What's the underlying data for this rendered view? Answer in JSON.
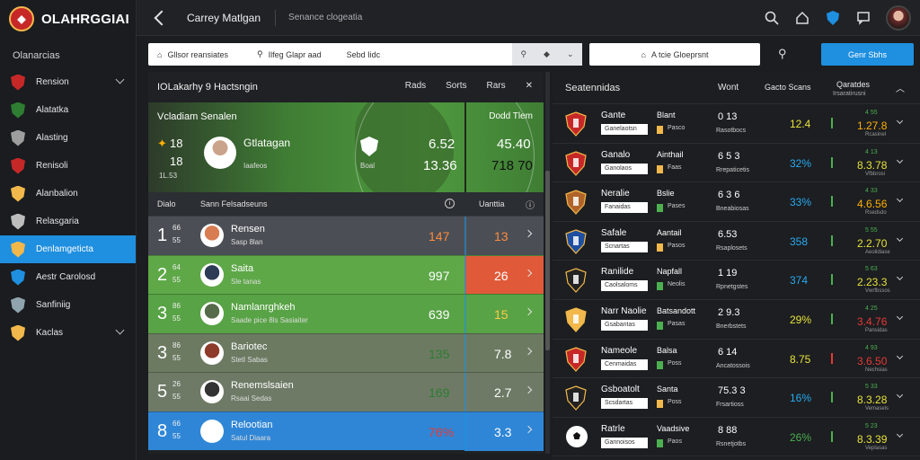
{
  "brand": {
    "name": "OLAHRGGIAI"
  },
  "sidebar": {
    "section": "Olanarcias",
    "items": [
      {
        "label": "Rension",
        "color": "#c62828",
        "chevron": true
      },
      {
        "label": "Alatatka",
        "color": "#2e7d32",
        "chevron": false
      },
      {
        "label": "Alasting",
        "color": "#9e9e9e",
        "chevron": false
      },
      {
        "label": "Renisoli",
        "color": "#c62828",
        "chevron": false
      },
      {
        "label": "Alanbalion",
        "color": "#f2b84b",
        "chevron": false
      },
      {
        "label": "Relasgaria",
        "color": "#bdbdbd",
        "chevron": false
      },
      {
        "label": "Denlamgeticta",
        "color": "#f2b84b",
        "chevron": false,
        "active": true
      },
      {
        "label": "Aestr Carolosd",
        "color": "#1f8fe0",
        "chevron": false
      },
      {
        "label": "Sanfiniig",
        "color": "#90a4ae",
        "chevron": false
      },
      {
        "label": "Kaclas",
        "color": "#f2b84b",
        "chevron": true
      }
    ]
  },
  "topbar": {
    "title": "Carrey Matlgan",
    "subtitle": "Senance clogeatia"
  },
  "filters": {
    "a": "Gllsor reansiates",
    "b": "Ilfeg Glapr aad",
    "c": "Sebd Iidc",
    "search": "A tcie Gloeprsnt",
    "button": "Genr Sbhs"
  },
  "panel": {
    "title": "IOLakarhy 9 Hactsngin",
    "cols": [
      "Rads",
      "Sorts",
      "Rars"
    ],
    "hero": {
      "title": "Vcladiam Senalen",
      "right_title": "Dodd Tlem",
      "n1": "18",
      "n2": "18",
      "n3": "1L.53",
      "name": "Gtlatagan",
      "name_sub": "Iaafeos",
      "badge_sub": "Boal",
      "s1": "6.52",
      "s2": "13.36",
      "r1": "45.40",
      "r2": "718 70"
    },
    "sub_header": {
      "a": "Dialo",
      "b": "Sann Felsadseuns",
      "c": "Uanttia"
    },
    "rows": [
      {
        "rank": "1",
        "s1": "66",
        "s2": "55",
        "name": "Rensen",
        "sub": "Sasp 8lan",
        "v1": "147",
        "v2": "13",
        "v1c": "#ff8a3d",
        "v2c": "#ff8a3d",
        "bg": "#4b4f55",
        "cell": "#4b4f55",
        "photo": "#d87c52"
      },
      {
        "rank": "2",
        "s1": "64",
        "s2": "55",
        "name": "Saita",
        "sub": "Sle tanas",
        "v1": "997",
        "v2": "26",
        "v1c": "#ffffff",
        "v2c": "#ffffff",
        "bg": "#5ea848",
        "cell": "#e05a3a",
        "photo": "#2e3b55"
      },
      {
        "rank": "3",
        "s1": "86",
        "s2": "55",
        "name": "Namlanrghkeh",
        "sub": "Saade pice 8ls Sasiaiter",
        "v1": "639",
        "v2": "15",
        "v1c": "#ffffff",
        "v2c": "#ffc94a",
        "bg": "#58a345",
        "cell": "#58a345",
        "photo": "#556b4a"
      },
      {
        "rank": "3",
        "s1": "86",
        "s2": "55",
        "name": "Bariotec",
        "sub": "Stetl Sabas",
        "v1": "135",
        "v2": "7.8",
        "v1c": "#2e7d32",
        "v2c": "#ffffff",
        "bg": "#6c7a62",
        "cell": "#6c7a62",
        "photo": "#8d3b2a"
      },
      {
        "rank": "5",
        "s1": "26",
        "s2": "55",
        "name": "Renemslsaien",
        "sub": "Rsaai Sedas",
        "v1": "169",
        "v2": "2.7",
        "v1c": "#2e7d32",
        "v2c": "#ffffff",
        "bg": "#6e7a66",
        "cell": "#6e7a66",
        "photo": "#333333"
      },
      {
        "rank": "8",
        "s1": "66",
        "s2": "55",
        "name": "Relootian",
        "sub": "Satul Diaara",
        "v1": "76%",
        "v2": "3.3",
        "v1c": "#e53935",
        "v2c": "#ffffff",
        "bg": "#2f86d6",
        "cell": "#2f86d6",
        "photo": "#ffffff"
      }
    ]
  },
  "rpanel": {
    "title": "Seatennidas",
    "cols": [
      "Wont",
      "Gacto Scans",
      "Qaratdes",
      "Irsaratirusni"
    ],
    "rows": [
      {
        "team": "Gante",
        "tag": "Ganelaotsn",
        "sub": "Blant",
        "sub2": "Pasco",
        "sq": "#f2b84b",
        "n1": "0 13",
        "n2": "Rasotbocs",
        "pct": "12.4",
        "pctc": "#e8e23a",
        "barc": "#4caf50",
        "oddtop": "4 55",
        "odd": "1.27.8",
        "oddc": "#ffb000",
        "odd2": "Rcasinel",
        "crest": "#c62828"
      },
      {
        "team": "Ganalo",
        "tag": "Ganolaos",
        "sub": "Ainthail",
        "sub2": "Faas",
        "sq": "#f2b84b",
        "n1": "6 5 3",
        "n2": "Rrepaticetis",
        "pct": "32%",
        "pctc": "#29a9f0",
        "barc": "#4caf50",
        "oddtop": "4 13",
        "odd": "8.3.78",
        "oddc": "#e8e23a",
        "odd2": "Vfbbrosi",
        "crest": "#c62828"
      },
      {
        "team": "Neralie",
        "tag": "Fanaidas",
        "sub": "Bslie",
        "sub2": "Pases",
        "sq": "#4caf50",
        "n1": "6 3 6",
        "n2": "Bneabiosas",
        "pct": "33%",
        "pctc": "#29a9f0",
        "barc": "#4caf50",
        "oddtop": "4 33",
        "odd": "4.6.56",
        "oddc": "#ffb000",
        "odd2": "Rsedsdo",
        "crest": "#b0642a"
      },
      {
        "team": "Safale",
        "tag": "Scnartas",
        "sub": "Aantail",
        "sub2": "Pasos",
        "sq": "#f2b84b",
        "n1": "6.53",
        "n2": "Rsaplosets",
        "pct": "358",
        "pctc": "#29a9f0",
        "barc": "#4caf50",
        "oddtop": "5 55",
        "odd": "2.2.70",
        "oddc": "#e8e23a",
        "odd2": "Aeolidiase",
        "crest": "#1f4fa0"
      },
      {
        "team": "Ranilide",
        "tag": "Caolsaloms",
        "sub": "Napfall",
        "sub2": "Neolis",
        "sq": "#4caf50",
        "n1": "1 19",
        "n2": "Rpnetgstes",
        "pct": "374",
        "pctc": "#29a9f0",
        "barc": "#4caf50",
        "oddtop": "5 63",
        "odd": "2.23.3",
        "oddc": "#e8e23a",
        "odd2": "Vwrfbssos",
        "crest": "#222222"
      },
      {
        "team": "Narr Naolie",
        "tag": "Gsabantas",
        "sub": "Batsandott",
        "sub2": "Pasas",
        "sq": "#4caf50",
        "n1": "2 9.3",
        "n2": "Bnerbstets",
        "pct": "29%",
        "pctc": "#e8e23a",
        "barc": "#4caf50",
        "oddtop": "4 25",
        "odd": "3.4.76",
        "oddc": "#e53935",
        "odd2": "Pansidas",
        "crest": "#f2b84b"
      },
      {
        "team": "Nameole",
        "tag": "Cenmaidas",
        "sub": "Balsa",
        "sub2": "Poss",
        "sq": "#4caf50",
        "n1": "6 14",
        "n2": "Ancatossois",
        "pct": "8.75",
        "pctc": "#e8e23a",
        "barc": "#e53935",
        "oddtop": "4 93",
        "odd": "3.6.50",
        "oddc": "#e53935",
        "odd2": "Nechsias",
        "crest": "#c62828"
      },
      {
        "team": "Gsboatolt",
        "tag": "Scsdartas",
        "sub": "Santa",
        "sub2": "Poss",
        "sq": "#f2b84b",
        "n1": "75.3 3",
        "n2": "Frsartioss",
        "pct": "16%",
        "pctc": "#29a9f0",
        "barc": "#4caf50",
        "oddtop": "5 33",
        "odd": "8.3.28",
        "oddc": "#e8e23a",
        "odd2": "Vemasels",
        "crest": "#222222"
      },
      {
        "team": "Ratrle",
        "tag": "Gannoisos",
        "sub": "Vaadsive",
        "sub2": "Paos",
        "sq": "#4caf50",
        "n1": "8 88",
        "n2": "Rsnetjotbs",
        "pct": "26%",
        "pctc": "#4caf50",
        "barc": "#4caf50",
        "oddtop": "5 23",
        "odd": "8.3.39",
        "oddc": "#e8e23a",
        "odd2": "Veplasas",
        "crest": "#ffffff"
      }
    ]
  }
}
